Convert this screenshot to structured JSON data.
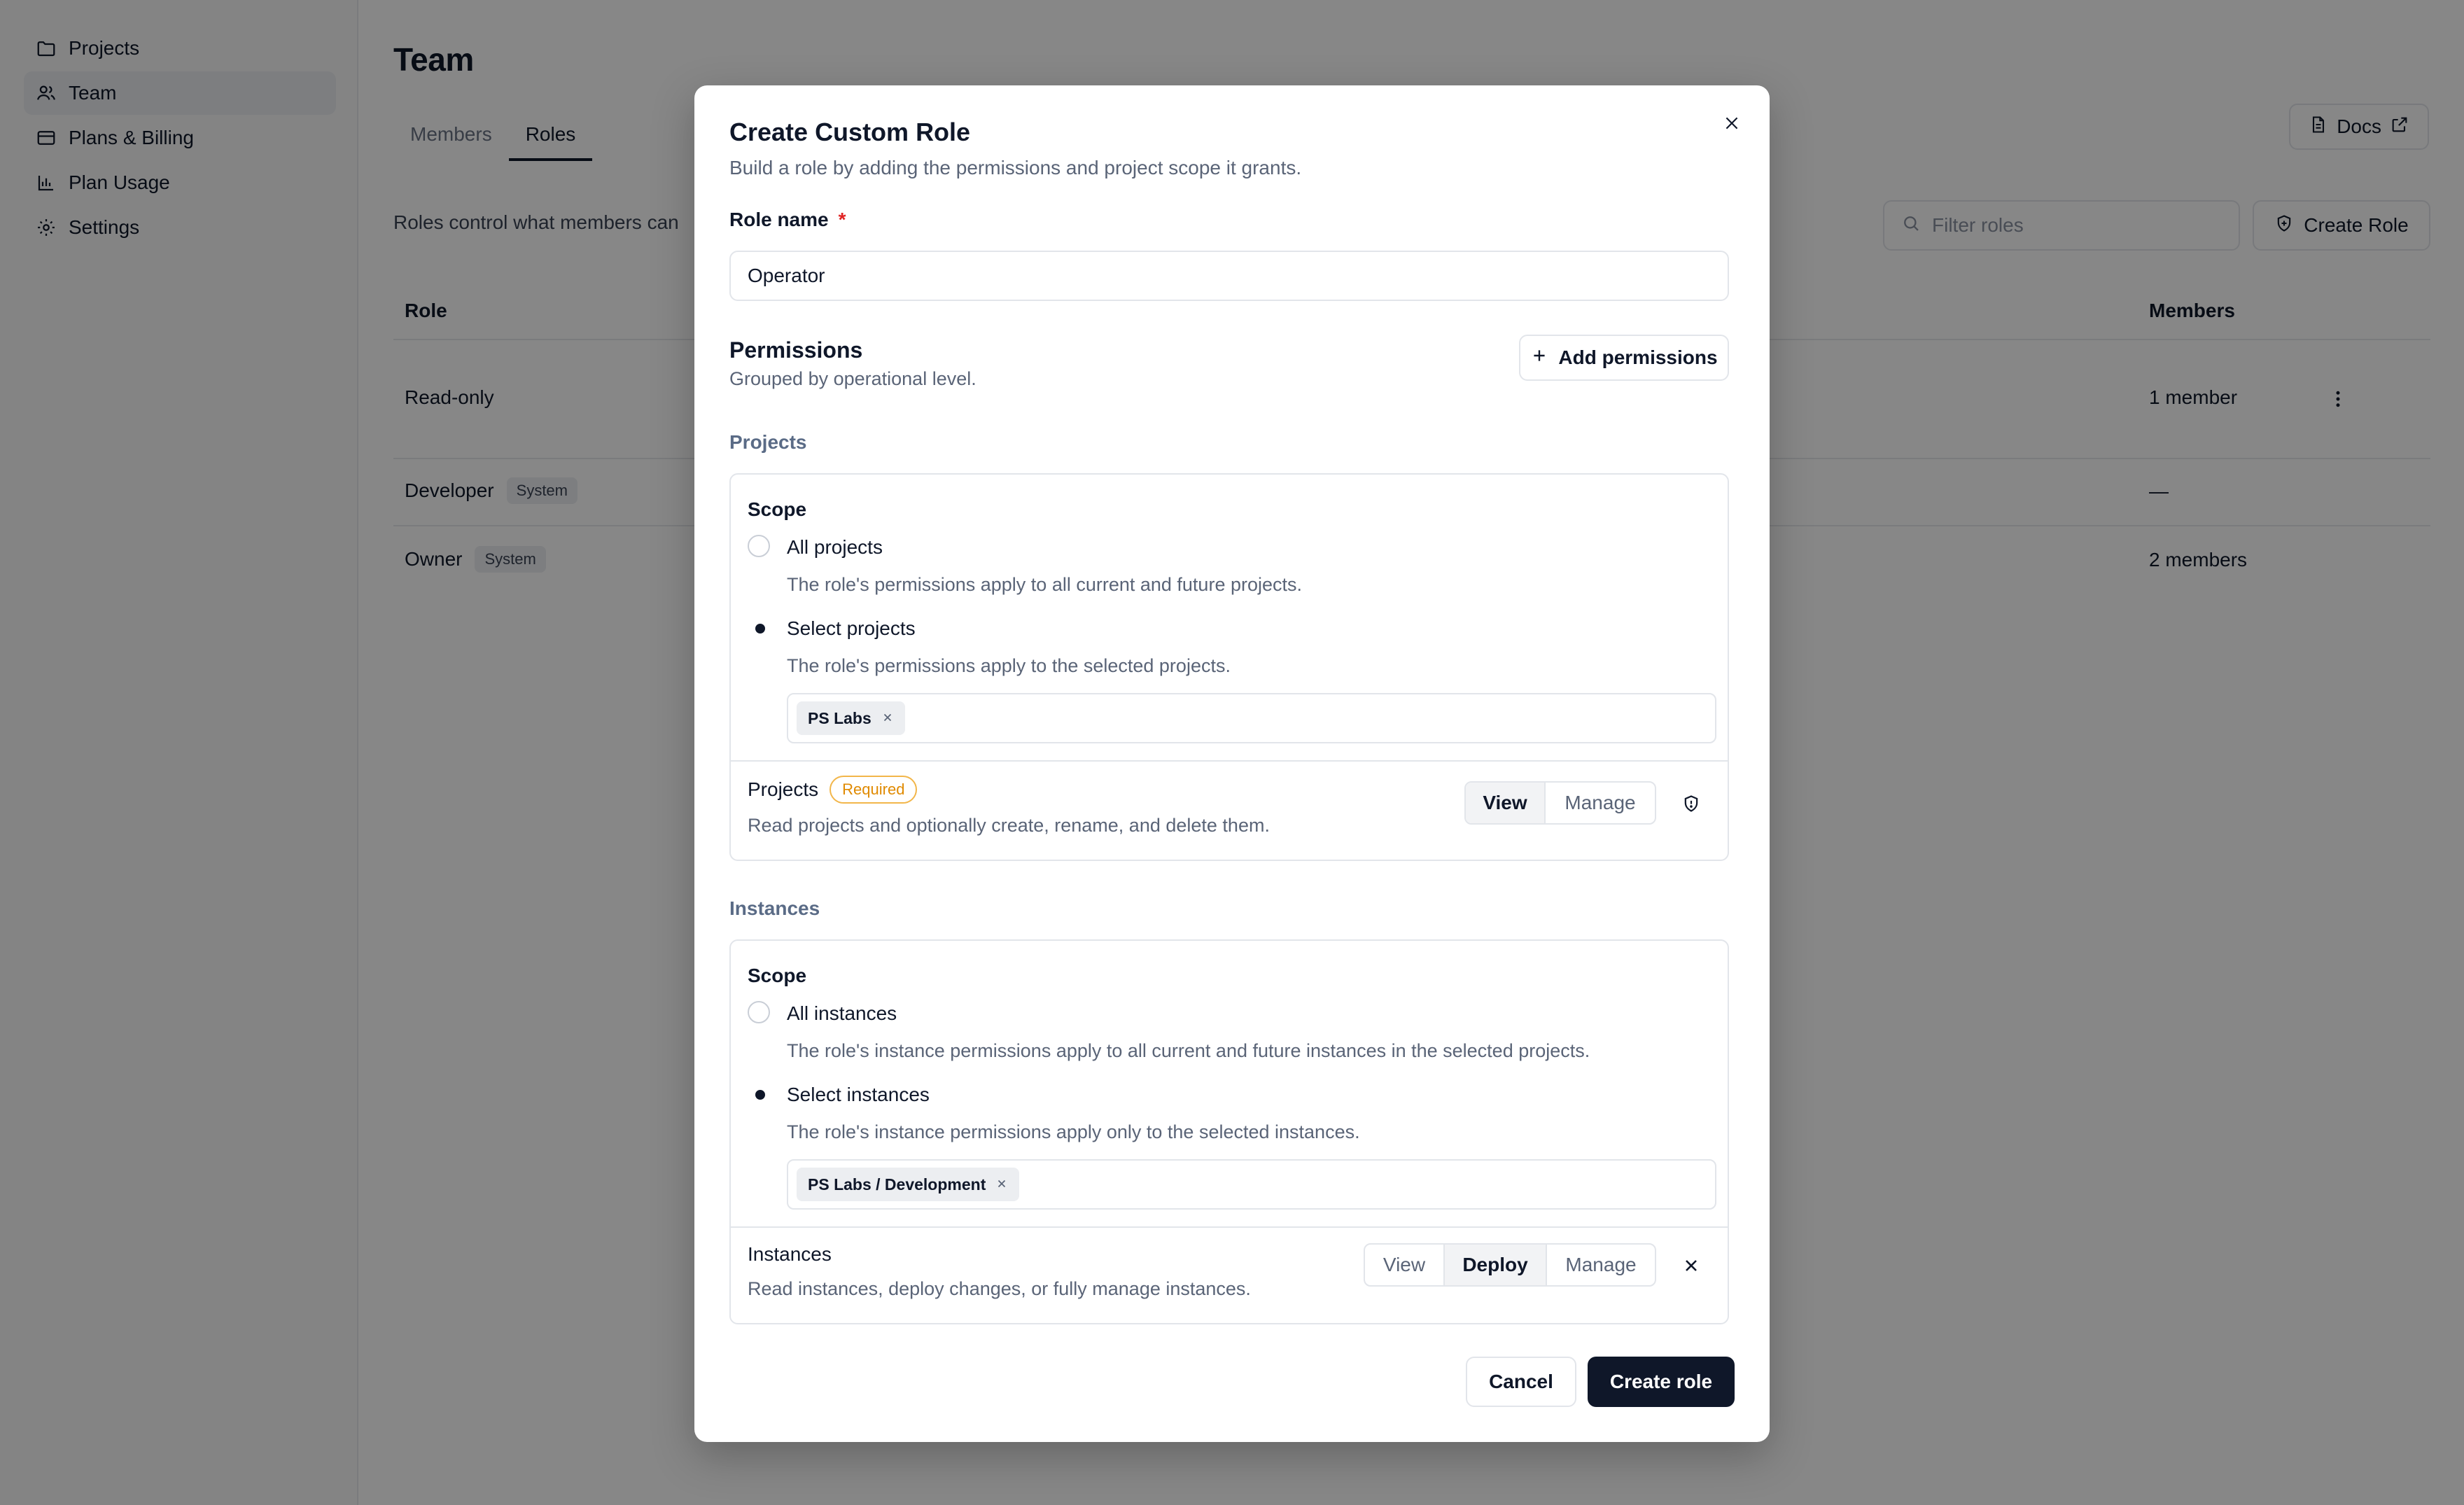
{
  "sidebar": {
    "items": [
      {
        "label": "Projects",
        "icon": "folder-icon"
      },
      {
        "label": "Team",
        "icon": "users-icon",
        "active": true
      },
      {
        "label": "Plans & Billing",
        "icon": "credit-card-icon"
      },
      {
        "label": "Plan Usage",
        "icon": "bar-chart-icon"
      },
      {
        "label": "Settings",
        "icon": "gear-icon"
      }
    ]
  },
  "page": {
    "title": "Team",
    "tabs": [
      "Members",
      "Roles"
    ],
    "active_tab": "Roles",
    "docs_label": "Docs",
    "description": "Roles control what members can",
    "filter_placeholder": "Filter roles",
    "create_role_label": "Create Role",
    "table": {
      "headers": {
        "role": "Role",
        "members": "Members"
      },
      "rows": [
        {
          "role": "Read-only",
          "badge": "",
          "members": "1 member"
        },
        {
          "role": "Developer",
          "badge": "System",
          "members": "—"
        },
        {
          "role": "Owner",
          "badge": "System",
          "members": "2 members"
        }
      ]
    }
  },
  "modal": {
    "title": "Create Custom Role",
    "subtitle": "Build a role by adding the permissions and project scope it grants.",
    "role_name_label": "Role name",
    "required_star": "*",
    "role_name_value": "Operator",
    "permissions_title": "Permissions",
    "permissions_subtitle": "Grouped by operational level.",
    "add_permissions_label": "Add permissions",
    "projects_group": {
      "label": "Projects",
      "scope_label": "Scope",
      "options": [
        {
          "label": "All projects",
          "desc": "The role's permissions apply to all current and future projects.",
          "checked": false
        },
        {
          "label": "Select projects",
          "desc": "The role's permissions apply to the selected projects.",
          "checked": true
        }
      ],
      "chips": [
        "PS Labs"
      ],
      "permission": {
        "name": "Projects",
        "badge": "Required",
        "desc": "Read projects and optionally create, rename, and delete them.",
        "levels": [
          "View",
          "Manage"
        ],
        "selected": "View",
        "trail_icon": "shield-icon"
      }
    },
    "instances_group": {
      "label": "Instances",
      "scope_label": "Scope",
      "options": [
        {
          "label": "All instances",
          "desc": "The role's instance permissions apply to all current and future instances in the selected projects.",
          "checked": false
        },
        {
          "label": "Select instances",
          "desc": "The role's instance permissions apply only to the selected instances.",
          "checked": true
        }
      ],
      "chips": [
        "PS Labs / Development"
      ],
      "permission": {
        "name": "Instances",
        "desc": "Read instances, deploy changes, or fully manage instances.",
        "levels": [
          "View",
          "Deploy",
          "Manage"
        ],
        "selected": "Deploy",
        "trail_icon": "close-icon"
      }
    },
    "cancel_label": "Cancel",
    "create_label": "Create role"
  }
}
